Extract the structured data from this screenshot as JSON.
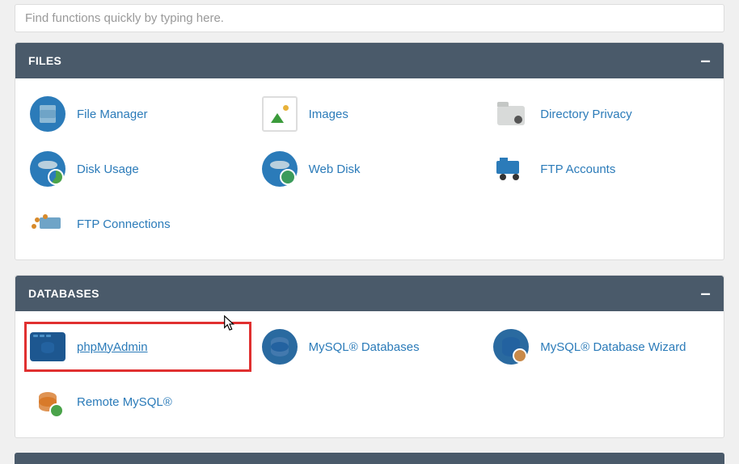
{
  "search": {
    "placeholder": "Find functions quickly by typing here."
  },
  "panels": {
    "files": {
      "title": "FILES",
      "items": [
        {
          "label": "File Manager"
        },
        {
          "label": "Images"
        },
        {
          "label": "Directory Privacy"
        },
        {
          "label": "Disk Usage"
        },
        {
          "label": "Web Disk"
        },
        {
          "label": "FTP Accounts"
        },
        {
          "label": "FTP Connections"
        }
      ]
    },
    "databases": {
      "title": "DATABASES",
      "items": [
        {
          "label": "phpMyAdmin"
        },
        {
          "label": "MySQL® Databases"
        },
        {
          "label": "MySQL® Database Wizard"
        },
        {
          "label": "Remote MySQL®"
        }
      ]
    }
  }
}
